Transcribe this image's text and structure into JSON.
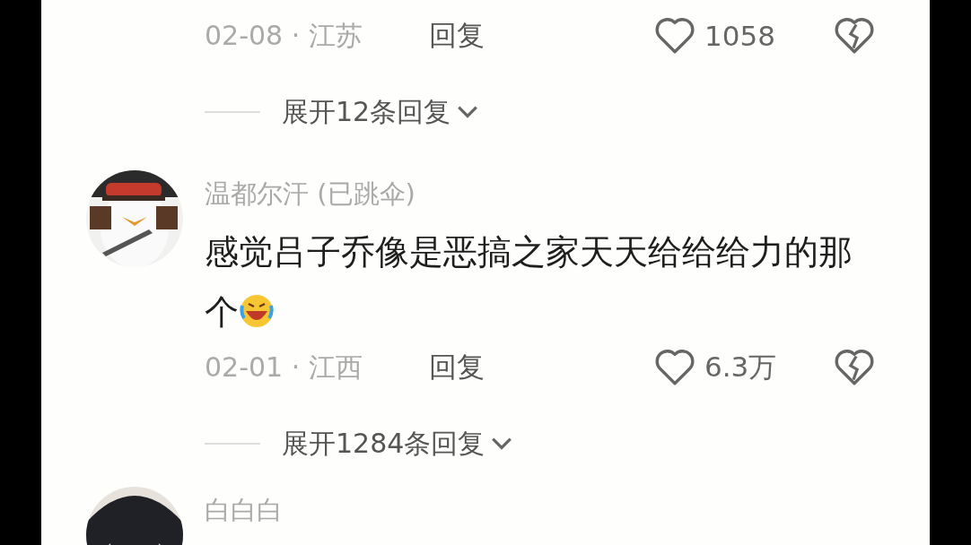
{
  "comments": [
    {
      "kind": "partial",
      "meta": "02-08 · 江苏",
      "reply_label": "回复",
      "likes": "1058",
      "expand_replies": "展开12条回复"
    },
    {
      "kind": "full",
      "username": "温都尔汗 (已跳伞)",
      "text": "感觉吕子乔像是恶搞之家天天给给给力的那个",
      "emoji": true,
      "meta": "02-01 · 江西",
      "reply_label": "回复",
      "likes": "6.3万",
      "expand_replies": "展开1284条回复"
    },
    {
      "kind": "full",
      "username": "白白白"
    }
  ]
}
